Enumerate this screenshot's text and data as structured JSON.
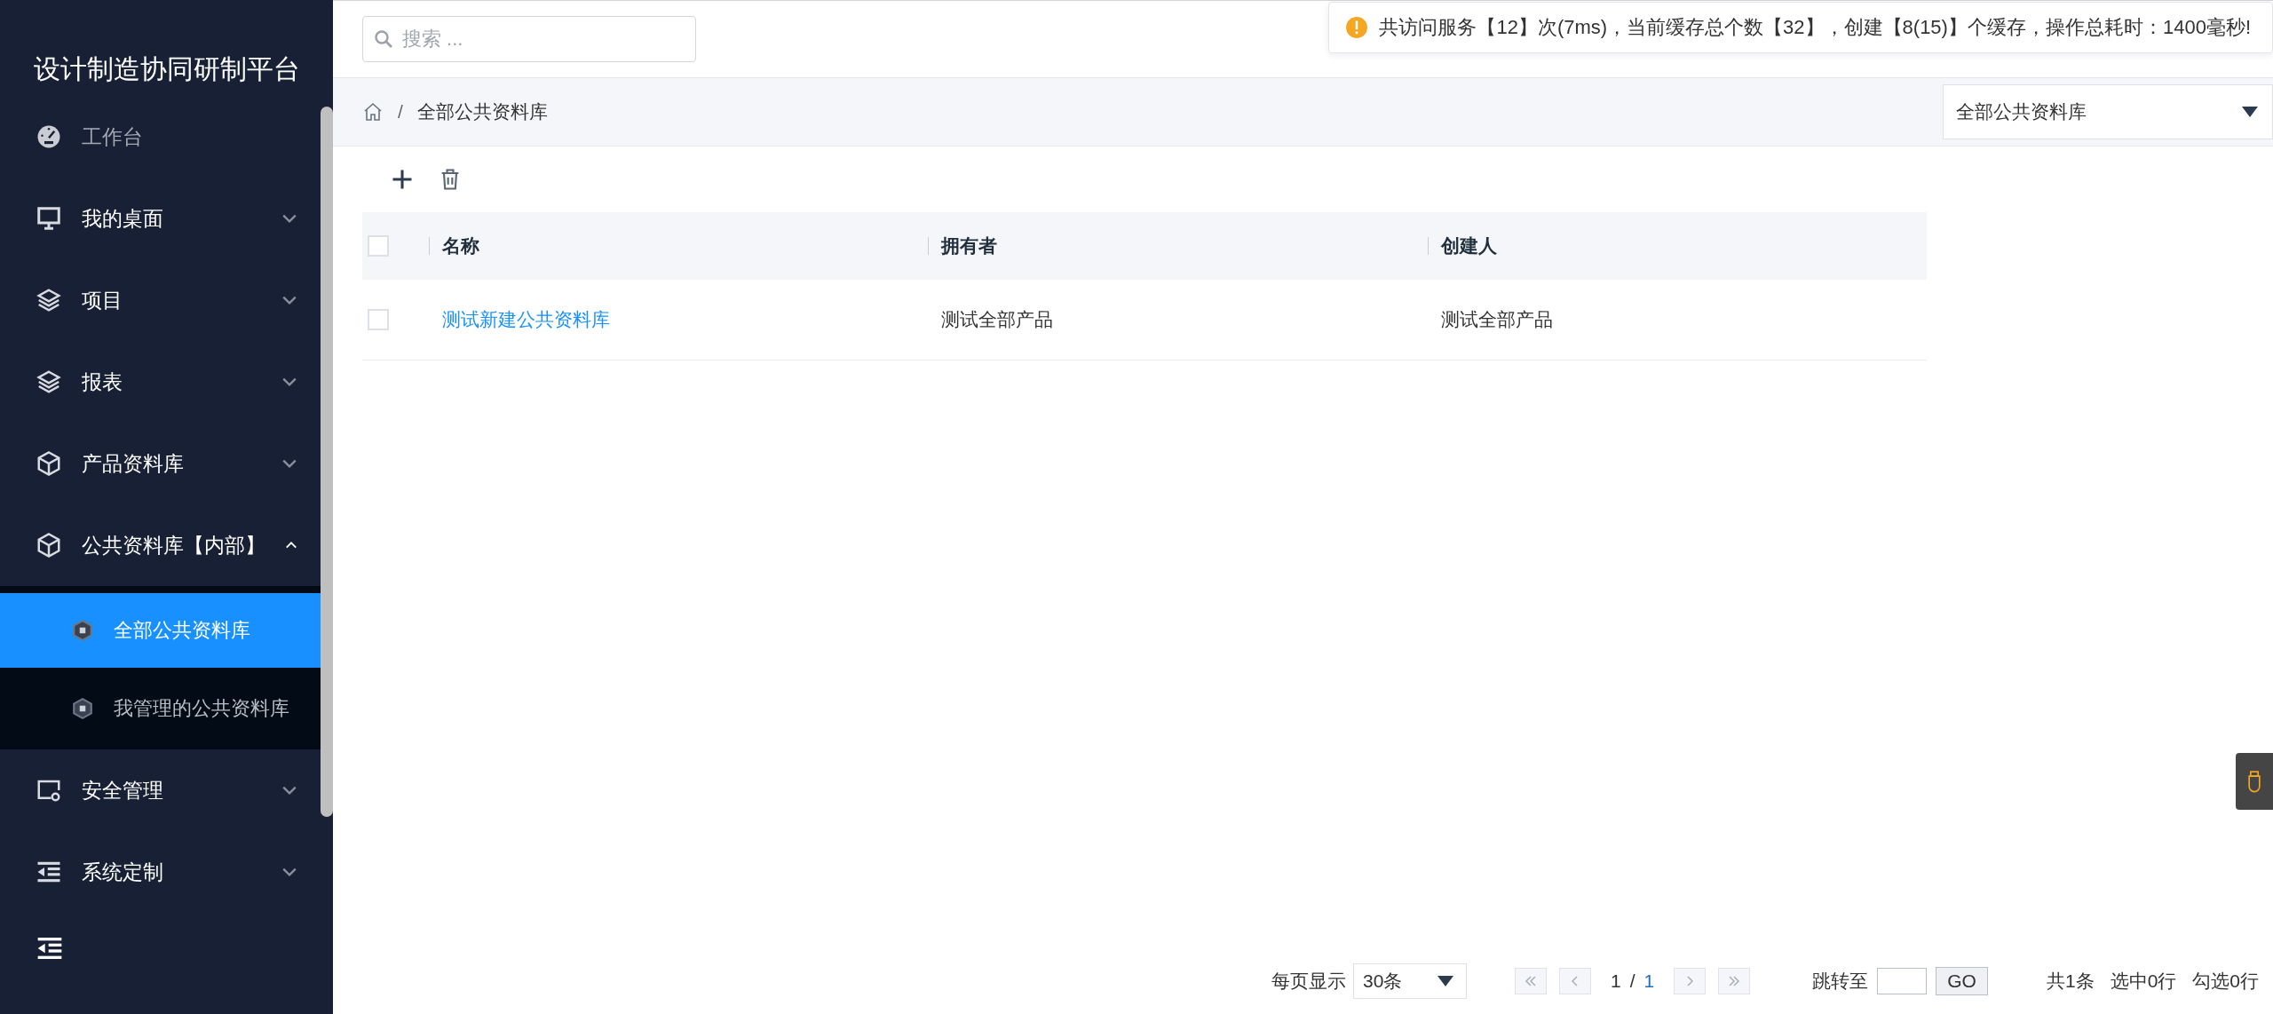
{
  "sidebar": {
    "title": "设计制造协同研制平台",
    "items": [
      {
        "label": "工作台",
        "kind": "link"
      },
      {
        "label": "我的桌面",
        "kind": "group",
        "expanded": false
      },
      {
        "label": "项目",
        "kind": "group",
        "expanded": false
      },
      {
        "label": "报表",
        "kind": "group",
        "expanded": false
      },
      {
        "label": "产品资料库",
        "kind": "group",
        "expanded": false
      },
      {
        "label": "公共资料库【内部】",
        "kind": "group",
        "expanded": true,
        "children": [
          {
            "label": "全部公共资料库",
            "selected": true
          },
          {
            "label": "我管理的公共资料库",
            "selected": false
          }
        ]
      },
      {
        "label": "安全管理",
        "kind": "group",
        "expanded": false
      },
      {
        "label": "系统定制",
        "kind": "group",
        "expanded": false
      }
    ]
  },
  "search": {
    "placeholder": "搜索 ..."
  },
  "notification": {
    "text": "共访问服务【12】次(7ms)，当前缓存总个数【32】，创建【8(15)】个缓存，操作总耗时：1400毫秒!"
  },
  "breadcrumb": {
    "separator": "/",
    "current": "全部公共资料库"
  },
  "library_select": {
    "value": "全部公共资料库"
  },
  "table": {
    "all_checked": false,
    "columns": [
      "名称",
      "拥有者",
      "创建人"
    ],
    "rows": [
      {
        "checked": false,
        "cells": [
          "测试新建公共资料库",
          "测试全部产品",
          "测试全部产品"
        ]
      }
    ]
  },
  "pagination": {
    "page_size_label": "每页显示",
    "page_size": "30条",
    "page": "1",
    "page_separator": "/",
    "total_pages": "1",
    "jump_label": "跳转至",
    "go": "GO",
    "summary": [
      "共1条",
      "选中0行",
      "勾选0行"
    ]
  }
}
